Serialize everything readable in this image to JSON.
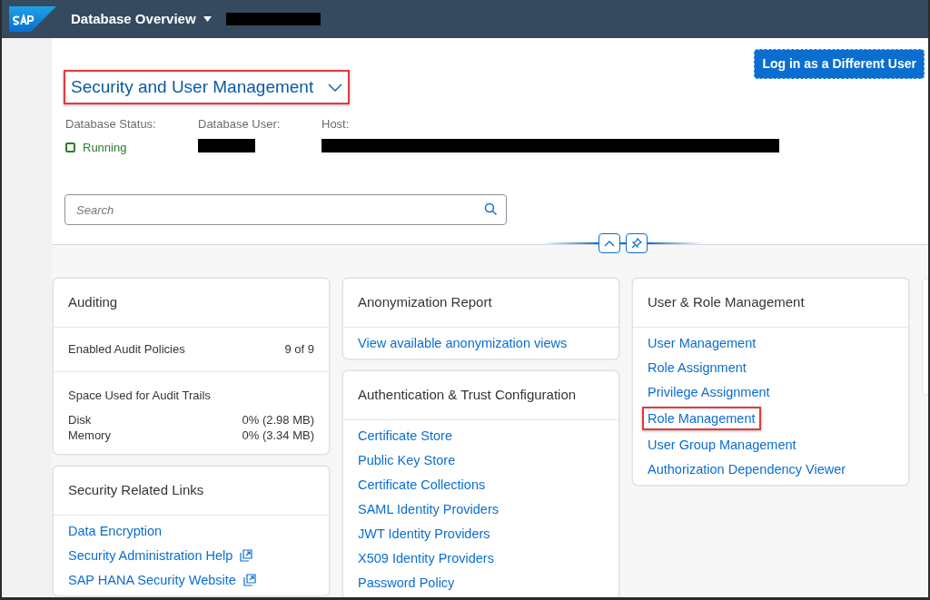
{
  "shell_bar": {
    "title": "Database Overview",
    "redacted": true
  },
  "header": {
    "title": "Security and User Management",
    "title_highlighted": true,
    "login_button": "Log in as a Different User",
    "attributes": [
      {
        "label": "Database Status:",
        "value": "Running",
        "kind": "status"
      },
      {
        "label": "Database User:",
        "kind": "redacted"
      },
      {
        "label": "Host:",
        "kind": "redacted"
      }
    ],
    "search": {
      "placeholder": "Search"
    }
  },
  "columns": [
    [
      {
        "title": "Auditing",
        "kind": "auditing",
        "policies": {
          "label": "Enabled Audit Policies",
          "value": "9 of 9"
        },
        "space": {
          "label": "Space Used for Audit Trails",
          "rows": [
            {
              "label": "Disk",
              "value": "0% (2.98 MB)"
            },
            {
              "label": "Memory",
              "value": "0% (3.34 MB)"
            }
          ]
        }
      },
      {
        "title": "Security Related Links",
        "kind": "links",
        "links": [
          {
            "label": "Data Encryption",
            "external": false,
            "highlighted": false
          },
          {
            "label": "Security Administration Help",
            "external": true,
            "highlighted": false
          },
          {
            "label": "SAP HANA Security Website",
            "external": true,
            "highlighted": false
          }
        ]
      }
    ],
    [
      {
        "title": "Anonymization Report",
        "kind": "links",
        "links": [
          {
            "label": "View available anonymization views",
            "external": false,
            "highlighted": false
          }
        ]
      },
      {
        "title": "Authentication & Trust Configuration",
        "kind": "links",
        "links": [
          {
            "label": "Certificate Store",
            "external": false,
            "highlighted": false
          },
          {
            "label": "Public Key Store",
            "external": false,
            "highlighted": false
          },
          {
            "label": "Certificate Collections",
            "external": false,
            "highlighted": false
          },
          {
            "label": "SAML Identity Providers",
            "external": false,
            "highlighted": false
          },
          {
            "label": "JWT Identity Providers",
            "external": false,
            "highlighted": false
          },
          {
            "label": "X509 Identity Providers",
            "external": false,
            "highlighted": false
          },
          {
            "label": "Password Policy",
            "external": false,
            "highlighted": false
          }
        ]
      }
    ],
    [
      {
        "title": "User & Role Management",
        "kind": "links",
        "links": [
          {
            "label": "User Management",
            "external": false,
            "highlighted": false
          },
          {
            "label": "Role Assignment",
            "external": false,
            "highlighted": false
          },
          {
            "label": "Privilege Assignment",
            "external": false,
            "highlighted": false
          },
          {
            "label": "Role Management",
            "external": false,
            "highlighted": true
          },
          {
            "label": "User Group Management",
            "external": false,
            "highlighted": false
          },
          {
            "label": "Authorization Dependency Viewer",
            "external": false,
            "highlighted": false
          }
        ]
      }
    ]
  ]
}
